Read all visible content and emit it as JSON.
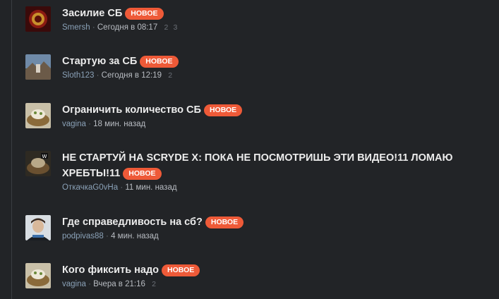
{
  "badge_label": "НОВОЕ",
  "topics": [
    {
      "title": "Засилие СБ",
      "author": "Smersh",
      "date": "Сегодня в 08:17",
      "stats": [
        "2",
        "3"
      ],
      "avatar": "red-emblem"
    },
    {
      "title": "Стартую за СБ",
      "author": "Sloth123",
      "date": "Сегодня в 12:19",
      "stats": [
        "2"
      ],
      "avatar": "landscape"
    },
    {
      "title": "Ограничить количество СБ",
      "author": "vagina",
      "date": "18 мин. назад",
      "stats": [],
      "avatar": "food"
    },
    {
      "title": "НЕ СТАРТУЙ НА SCRYDE X: ПОКА НЕ ПОСМОТРИШЬ ЭТИ ВИДЕО!11 ЛОМАЮ ХРЕБТЫ!11",
      "author": "ОткачкаG0vHa",
      "date": "11 мин. назад",
      "stats": [],
      "avatar": "food-dark"
    },
    {
      "title": "Где справедливость на сб?",
      "author": "podpivas88",
      "date": "4 мин. назад",
      "stats": [],
      "avatar": "person"
    },
    {
      "title": "Кого фиксить надо",
      "author": "vagina",
      "date": "Вчера в 21:16",
      "stats": [
        "2"
      ],
      "avatar": "food"
    }
  ]
}
